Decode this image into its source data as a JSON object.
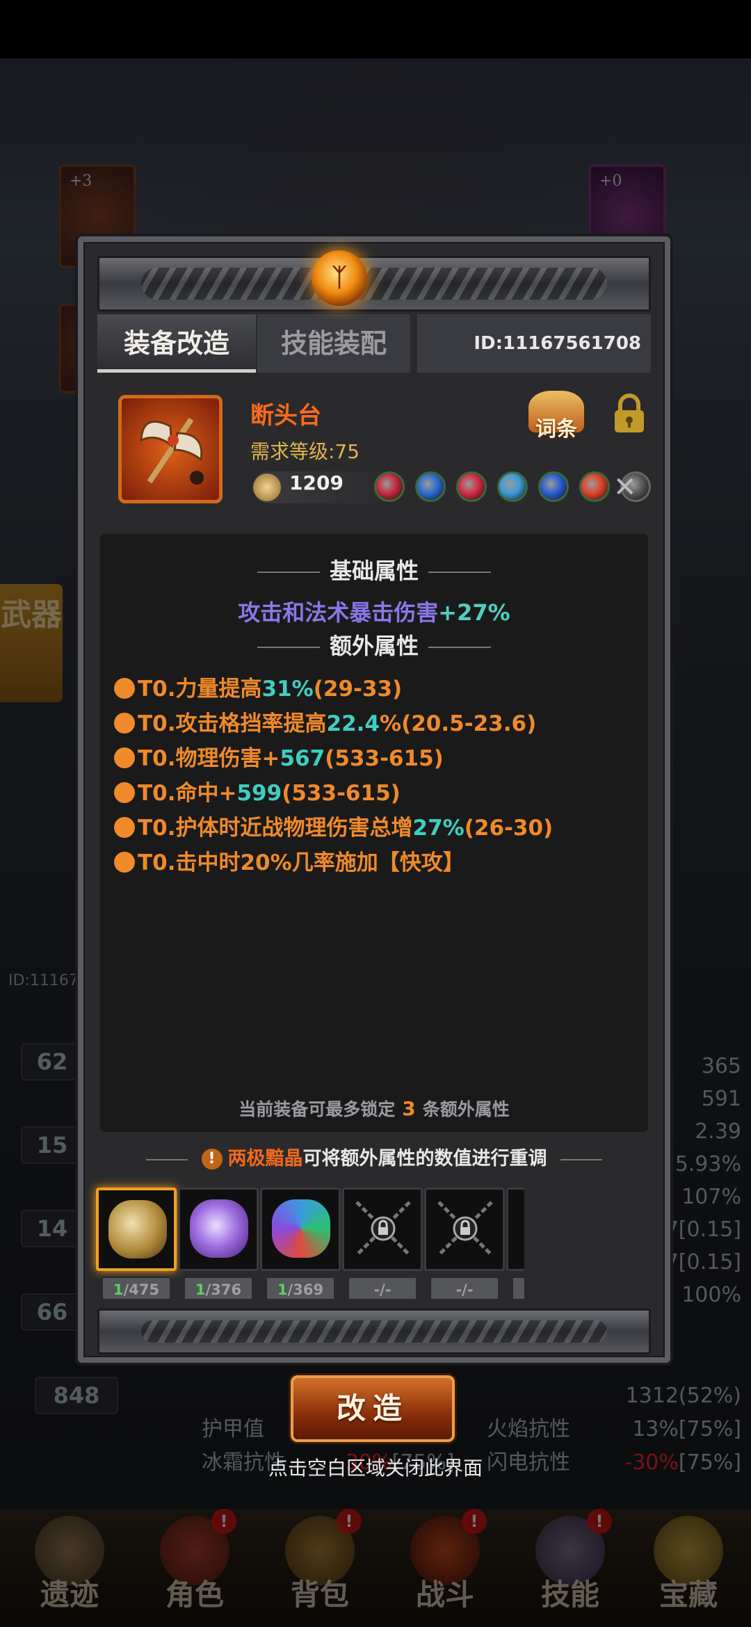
{
  "background": {
    "slot_levels": [
      "+3",
      "+0"
    ],
    "side_tab": "武器",
    "left_id": "ID:11167",
    "left_badges": [
      "62",
      "15",
      "14",
      "66",
      "848"
    ],
    "right_values": [
      "365",
      "591",
      "2.39",
      "5.93%",
      "107%",
      "7[0.15]",
      "7[0.15]",
      "100%"
    ],
    "bottom_rows": [
      {
        "left": "",
        "right": "1312(52%)"
      },
      {
        "left": "护甲值",
        "mid": "火焰抗性",
        "right": "13%[75%]"
      },
      {
        "left": "冰霜抗性",
        "mid_red": "-30%",
        "mid_tail": "[75%]",
        "mid": "闪电抗性",
        "right_red": "-30%",
        "right": "[75%]"
      }
    ],
    "nav": [
      {
        "label": "遗迹",
        "icon": "relic-icon",
        "badge": ""
      },
      {
        "label": "角色",
        "icon": "character-icon",
        "badge": "!"
      },
      {
        "label": "背包",
        "icon": "bag-icon",
        "badge": "!"
      },
      {
        "label": "战斗",
        "icon": "battle-icon",
        "badge": "!"
      },
      {
        "label": "技能",
        "icon": "skill-book-icon",
        "badge": "!"
      },
      {
        "label": "宝藏",
        "icon": "treasure-icon",
        "badge": ""
      }
    ]
  },
  "modal": {
    "tabs": [
      {
        "label": "装备改造",
        "active": true
      },
      {
        "label": "技能装配",
        "active": false
      }
    ],
    "player_id": "ID:11167561708",
    "item": {
      "name": "断头台",
      "requirement": "需求等级:75",
      "power": "1209",
      "icon": "axe-icon",
      "sockets": [
        "#c02838",
        "#2a6ad0",
        "#d02a40",
        "#3a9ad8",
        "#2a5ad0",
        "#e0402a",
        "#555"
      ]
    },
    "entry_button": "词条",
    "base_title": "基础属性",
    "base_attr": {
      "text": "攻击和法术暴击伤害",
      "value": "+27%"
    },
    "extra_title": "额外属性",
    "extra_attrs": [
      {
        "prefix": "T0.力量提高",
        "value": "31%",
        "range": "(29-33)"
      },
      {
        "prefix": "T0.攻击格挡率提高",
        "value": "22.4",
        "suffix": "%",
        "range": "(20.5-23.6)"
      },
      {
        "prefix": "T0.物理伤害+",
        "value": "567",
        "range": "(533-615)"
      },
      {
        "prefix": "T0.命中+",
        "value": "599",
        "range": "(533-615)"
      },
      {
        "prefix": "T0.护体时近战物理伤害总增",
        "value": "27%",
        "range": "(26-30)"
      },
      {
        "prefix": "T0.击中时20%几率施加【快攻】",
        "value": "",
        "range": ""
      }
    ],
    "lock_note": {
      "before": "当前装备可最多锁定",
      "count": "3",
      "after": "条额外属性"
    },
    "tip": {
      "highlight": "两极黯晶",
      "text": "可将额外属性的数值进行重调"
    },
    "materials": [
      {
        "have": "1",
        "total": "/475",
        "selected": true,
        "color": "gold"
      },
      {
        "have": "1",
        "total": "/376",
        "selected": false,
        "color": "purple"
      },
      {
        "have": "1",
        "total": "/369",
        "selected": false,
        "color": "rainbow"
      },
      {
        "have": "",
        "total": "-/-",
        "selected": false,
        "locked": true
      },
      {
        "have": "",
        "total": "-/-",
        "selected": false,
        "locked": true
      }
    ],
    "reform_button": "改造",
    "close_hint": "点击空白区域关闭此界面"
  }
}
